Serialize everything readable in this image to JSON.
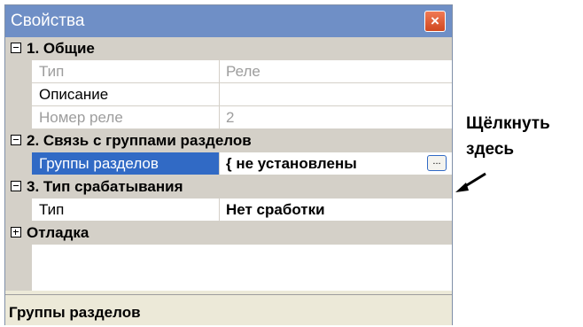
{
  "window": {
    "title": "Свойства",
    "close_symbol": "×"
  },
  "grid": {
    "categories": [
      {
        "label": "1. Общие",
        "expand_state": "expanded"
      },
      {
        "label": "2. Связь с группами разделов",
        "expand_state": "expanded"
      },
      {
        "label": "3. Тип срабатывания",
        "expand_state": "expanded"
      },
      {
        "label": "Отладка",
        "expand_state": "collapsed"
      }
    ],
    "props": {
      "type": {
        "name": "Тип",
        "value": "Реле",
        "enabled": false
      },
      "description": {
        "name": "Описание",
        "value": "",
        "enabled": true
      },
      "relay_number": {
        "name": "Номер реле",
        "value": "2",
        "enabled": false
      },
      "section_groups": {
        "name": "Группы разделов",
        "value": "{ не установлены",
        "selected": true,
        "button_label": "..."
      },
      "trigger_type": {
        "name": "Тип",
        "value": "Нет сработки",
        "enabled": true
      }
    }
  },
  "description_panel": {
    "text": "Группы разделов"
  },
  "annotation": {
    "line1": "Щёлкнуть",
    "line2": "здесь"
  }
}
